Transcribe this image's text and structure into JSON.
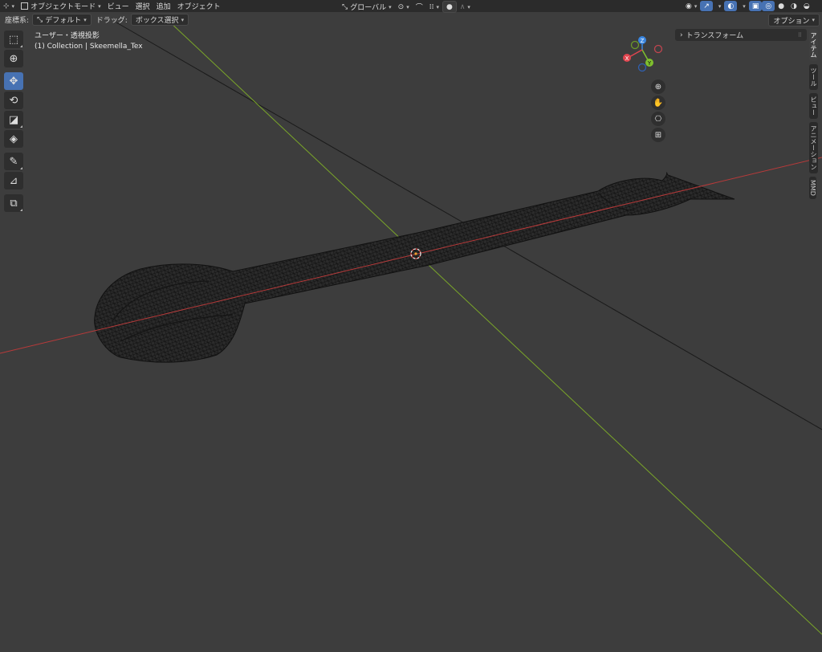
{
  "header": {
    "mode": "オブジェクトモード",
    "menus": [
      "ビュー",
      "選択",
      "追加",
      "オブジェクト"
    ],
    "orientation": "グローバル",
    "options": "オプション"
  },
  "subheader": {
    "coord_label": "座標系:",
    "coord_value": "デフォルト",
    "drag_label": "ドラッグ:",
    "drag_value": "ボックス選択"
  },
  "viewport": {
    "view_name": "ユーザー・透視投影",
    "collection": "(1) Collection | Skeemella_Tex"
  },
  "tools": [
    {
      "name": "select-box-tool"
    },
    {
      "name": "cursor-tool"
    },
    {
      "name": "move-tool",
      "active": true
    },
    {
      "name": "rotate-tool"
    },
    {
      "name": "scale-tool"
    },
    {
      "name": "transform-tool"
    },
    {
      "name": "annotate-tool"
    },
    {
      "name": "measure-tool"
    },
    {
      "name": "add-cube-tool"
    }
  ],
  "gizmo": {
    "x": "X",
    "y": "Y",
    "z": "Z",
    "colors": {
      "x": "#e0454f",
      "y": "#7fbf2e",
      "z": "#3a86e0"
    }
  },
  "sidebar": {
    "panel": "トランスフォーム",
    "tabs": [
      "アイテム",
      "ツール",
      "ビュー",
      "アニメーション",
      "MMD"
    ]
  },
  "colors": {
    "background": "#3d3d3d",
    "x_axis": "#b83a3a",
    "y_axis": "#7aa629",
    "accent": "#4772b3"
  }
}
